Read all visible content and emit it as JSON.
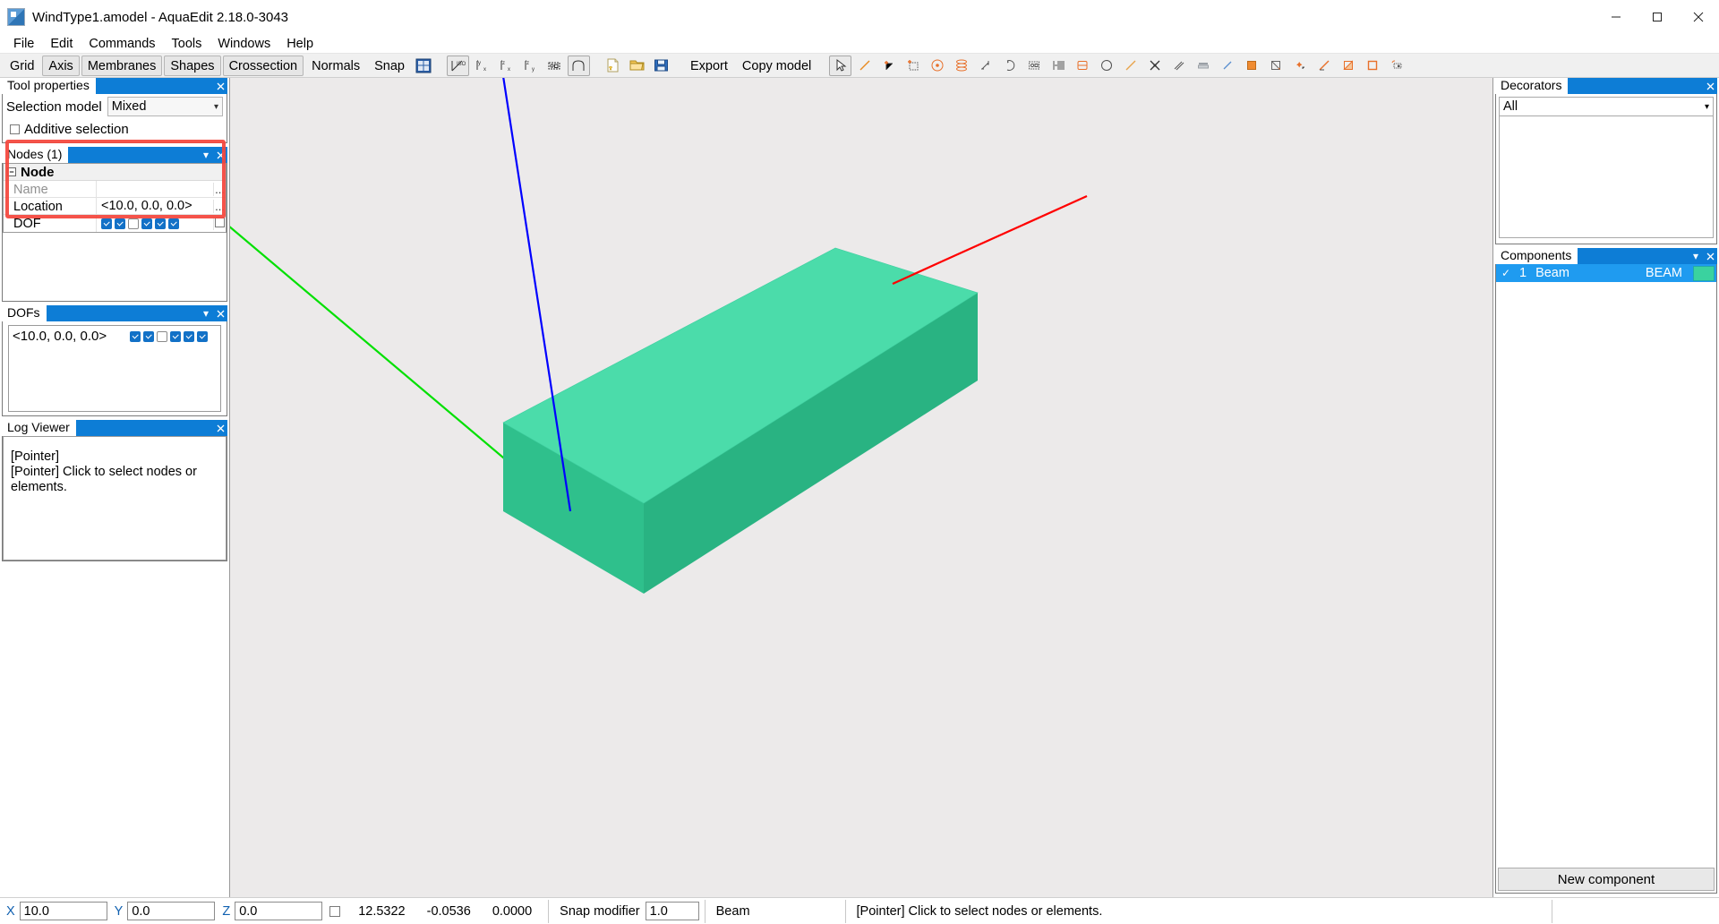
{
  "window": {
    "title": "WindType1.amodel - AquaEdit 2.18.0-3043",
    "minimize": "–",
    "maximize": "❐",
    "close": "✕"
  },
  "menu": {
    "items": [
      {
        "label": "File"
      },
      {
        "label": "Edit"
      },
      {
        "label": "Commands"
      },
      {
        "label": "Tools"
      },
      {
        "label": "Windows"
      },
      {
        "label": "Help"
      }
    ]
  },
  "toolbar": {
    "toggles": [
      {
        "label": "Grid",
        "boxed": false
      },
      {
        "label": "Axis",
        "boxed": true
      },
      {
        "label": "Membranes",
        "boxed": true
      },
      {
        "label": "Shapes",
        "boxed": true
      },
      {
        "label": "Crossection",
        "boxed": true
      },
      {
        "label": "Normals",
        "boxed": false
      },
      {
        "label": "Snap",
        "boxed": false
      }
    ],
    "snap_icon": "snap-grid-icon",
    "view_icons": [
      {
        "name": "iso-view-icon",
        "label": "ISO"
      },
      {
        "name": "view-x-icon",
        "label": "x"
      },
      {
        "name": "view-z-x-icon",
        "label": "x"
      },
      {
        "name": "view-z-y-icon",
        "label": "y"
      },
      {
        "name": "view-fit-icon",
        "label": ""
      },
      {
        "name": "crossection-icon",
        "label": ""
      }
    ],
    "file_icons": [
      {
        "name": "new-file-icon"
      },
      {
        "name": "open-folder-icon"
      },
      {
        "name": "save-icon"
      }
    ],
    "export_label": "Export",
    "copy_model_label": "Copy model",
    "tool_icons": [
      {
        "name": "pointer-tool-icon",
        "active": true
      },
      {
        "name": "line-tool-icon"
      },
      {
        "name": "add-node-icon"
      },
      {
        "name": "add-grid-node-icon"
      },
      {
        "name": "center-point-icon"
      },
      {
        "name": "extrude-stack-icon"
      },
      {
        "name": "scale-icon"
      },
      {
        "name": "rotate-icon"
      },
      {
        "name": "select-box-icon"
      },
      {
        "name": "array-icon"
      },
      {
        "name": "cylinder-icon"
      },
      {
        "name": "half-circle-icon"
      },
      {
        "name": "diagonal-line-icon"
      },
      {
        "name": "cross-snap-icon"
      },
      {
        "name": "parallel-lines-icon"
      },
      {
        "name": "align-icon"
      },
      {
        "name": "short-line-icon"
      },
      {
        "name": "filled-square-icon"
      },
      {
        "name": "empty-square-icon"
      },
      {
        "name": "point-snap-icon"
      },
      {
        "name": "angle-line-icon"
      },
      {
        "name": "triangle-square-icon"
      },
      {
        "name": "outline-square-icon"
      },
      {
        "name": "measure-icon"
      }
    ]
  },
  "tool_properties": {
    "title": "Tool properties",
    "selection_model_label": "Selection model",
    "selection_model_value": "Mixed",
    "additive_selection_label": "Additive selection",
    "additive_selection_checked": false
  },
  "nodes_panel": {
    "title": "Nodes (1)",
    "group_label": "Node",
    "rows": [
      {
        "key": "Name",
        "value": "",
        "dim": true,
        "ellipsis": "..."
      },
      {
        "key": "Location",
        "value": "<10.0, 0.0, 0.0>",
        "dim": false,
        "ellipsis": "..."
      }
    ],
    "dof_label": "DOF",
    "dof_states": [
      true,
      true,
      false,
      true,
      true,
      true
    ],
    "highlight_color": "#f4463c"
  },
  "dofs_panel": {
    "title": "DOFs",
    "entry_label": "<10.0, 0.0, 0.0>",
    "dof_states": [
      true,
      true,
      false,
      true,
      true,
      true
    ]
  },
  "log_viewer": {
    "title": "Log Viewer",
    "lines": [
      "[Pointer]",
      "[Pointer] Click to select nodes or",
      "elements."
    ]
  },
  "decorators": {
    "title": "Decorators",
    "filter_value": "All"
  },
  "components": {
    "title": "Components",
    "rows": [
      {
        "check": "✓",
        "number": "1",
        "name": "Beam",
        "type": "BEAM",
        "color": "#3ad29f"
      }
    ],
    "new_component_label": "New component"
  },
  "viewport": {
    "axis_colors": {
      "x": "#ff0000",
      "y": "#00e000",
      "z": "#0000ff"
    },
    "model_color_top": "#4bdcaa",
    "model_color_front": "#2fc08c",
    "model_color_side": "#29b382",
    "background": "#eceaea"
  },
  "statusbar": {
    "x_label": "X",
    "x_value": "10.0",
    "y_label": "Y",
    "y_value": "0.0",
    "z_label": "Z",
    "z_value": "0.0",
    "lock_checked": false,
    "num1": "12.5322",
    "num2": "-0.0536",
    "num3": "0.0000",
    "snap_modifier_label": "Snap modifier",
    "snap_modifier_value": "1.0",
    "mode_label": "Beam",
    "message": "[Pointer] Click to select nodes or elements."
  }
}
